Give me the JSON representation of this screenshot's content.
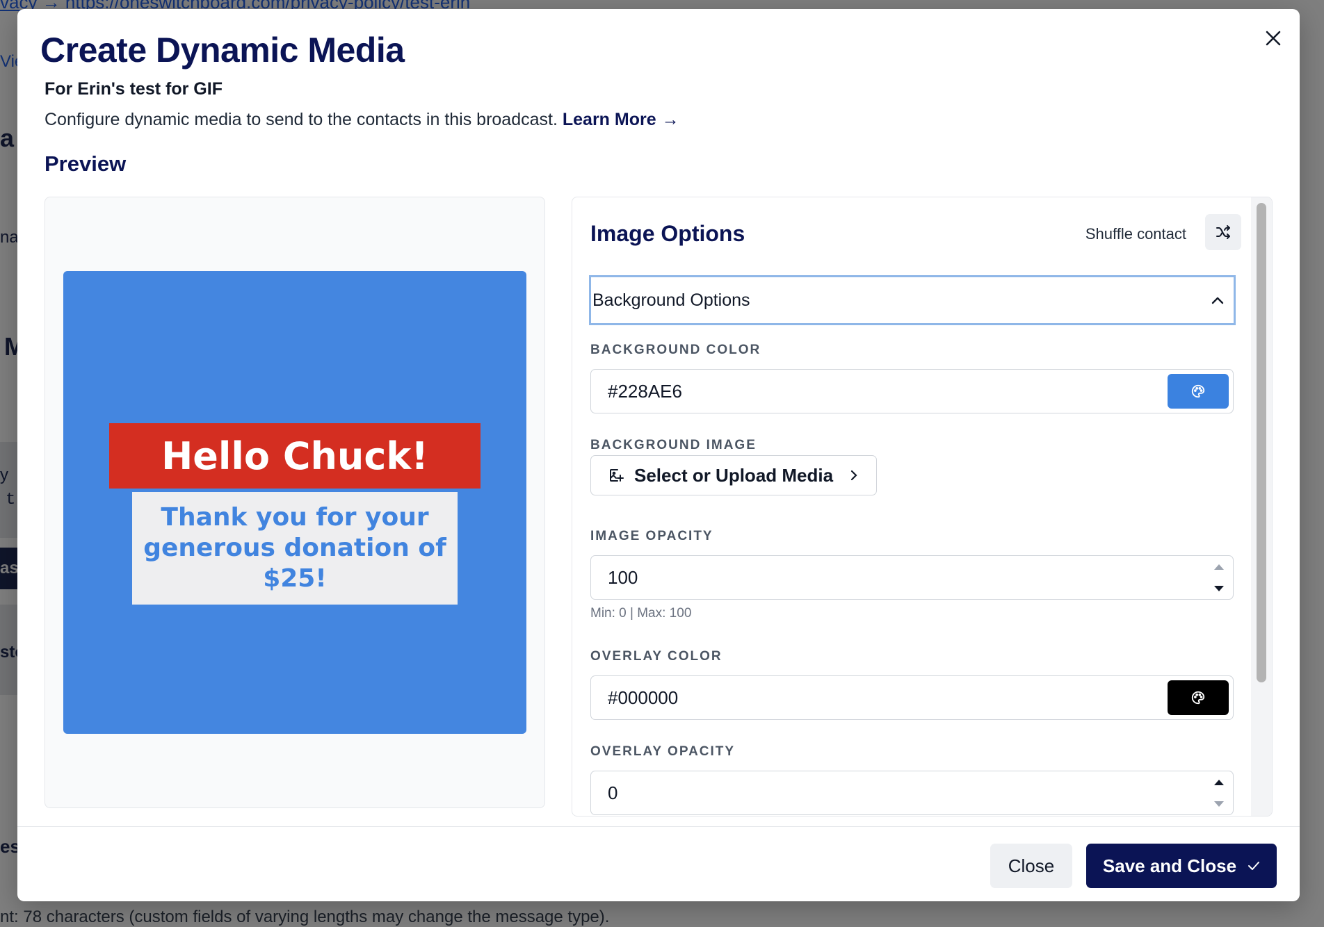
{
  "background_page": {
    "top_link": "vacy  →  https://oneswitchboard.com/privacy-policy/test-erin",
    "bottom_note": "nt: 78 characters (custom fields of varying lengths may change the message type).",
    "fragments": [
      "Vie",
      "a",
      "nag",
      "M",
      "y",
      "t",
      "as",
      "sto",
      "es"
    ]
  },
  "modal": {
    "title": "Create Dynamic Media",
    "subtitle": "For Erin's test for GIF",
    "description": "Configure dynamic media to send to the contacts in this broadcast.",
    "learn_more": "Learn More",
    "preview_heading": "Preview",
    "preview": {
      "headline": "Hello Chuck!",
      "message": "Thank you for your generous donation of $25!",
      "colors": {
        "background": "#4486e0",
        "headline_bg": "#d42e21",
        "message_text": "#4184df"
      }
    },
    "options": {
      "title": "Image Options",
      "shuffle_label": "Shuffle contact",
      "section_title": "Background Options",
      "background_color_label": "BACKGROUND COLOR",
      "background_color_value": "#228AE6",
      "background_image_label": "BACKGROUND IMAGE",
      "select_media_label": "Select or Upload Media",
      "image_opacity_label": "IMAGE OPACITY",
      "image_opacity_value": "100",
      "image_opacity_hint": "Min: 0 | Max: 100",
      "overlay_color_label": "OVERLAY COLOR",
      "overlay_color_value": "#000000",
      "overlay_opacity_label": "OVERLAY OPACITY",
      "overlay_opacity_value": "0"
    },
    "footer": {
      "close_label": "Close",
      "save_label": "Save and Close"
    },
    "colors": {
      "brand_navy": "#0b1455",
      "swatch_blue": "#3b82e0",
      "swatch_black": "#000000"
    }
  }
}
